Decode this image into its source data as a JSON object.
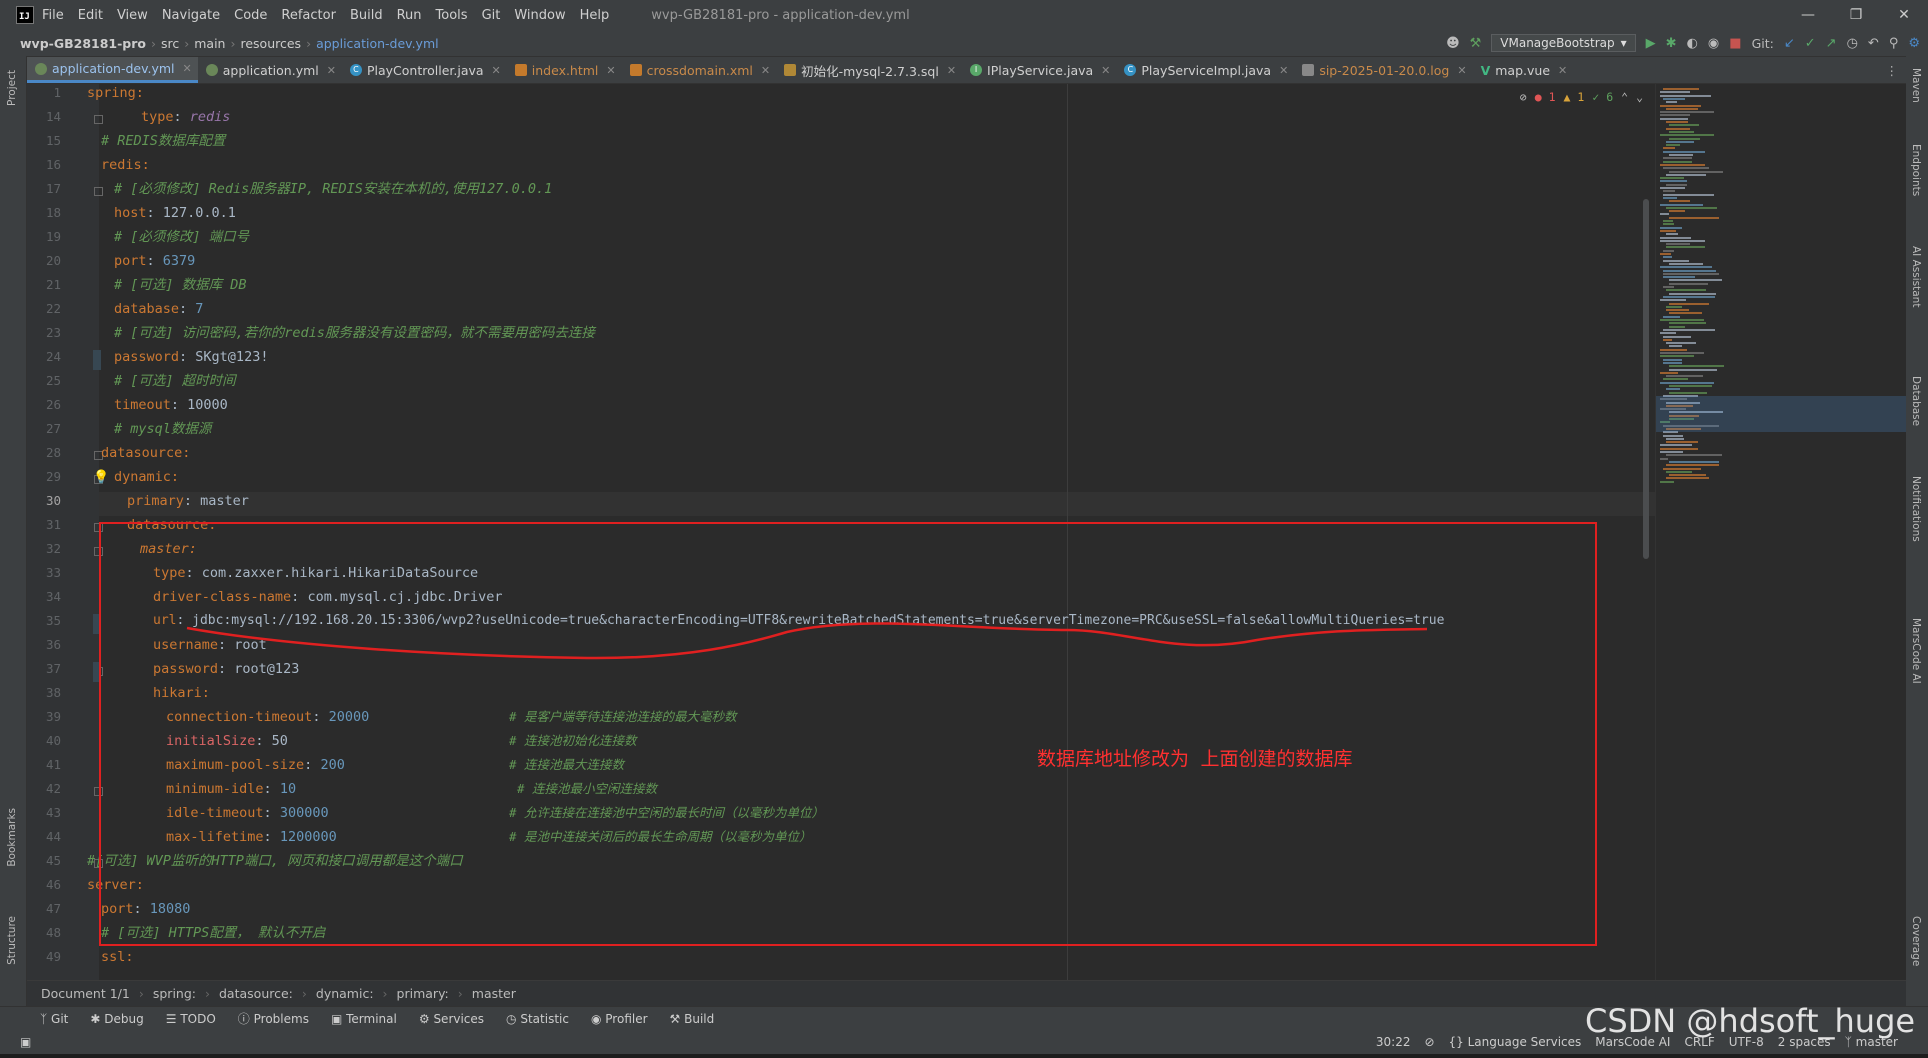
{
  "titlebar": {
    "menus": [
      "File",
      "Edit",
      "View",
      "Navigate",
      "Code",
      "Refactor",
      "Build",
      "Run",
      "Tools",
      "Git",
      "Window",
      "Help"
    ],
    "window_title": "wvp-GB28181-pro - application-dev.yml"
  },
  "navbar": {
    "crumbs": [
      "wvp-GB28181-pro",
      "src",
      "main",
      "resources",
      "application-dev.yml"
    ],
    "run_config": "VManageBootstrap",
    "git_label": "Git:"
  },
  "tabs": [
    {
      "label": "application-dev.yml",
      "active": true
    },
    {
      "label": "application.yml"
    },
    {
      "label": "PlayController.java"
    },
    {
      "label": "index.html"
    },
    {
      "label": "crossdomain.xml"
    },
    {
      "label": "初始化-mysql-2.7.3.sql"
    },
    {
      "label": "IPlayService.java"
    },
    {
      "label": "PlayServiceImpl.java"
    },
    {
      "label": "sip-2025-01-20.0.log"
    },
    {
      "label": "map.vue"
    }
  ],
  "inspections": {
    "errors": "1",
    "warnings": "1",
    "ok": "6"
  },
  "editor": {
    "line_numbers": [
      "1",
      "14",
      "15",
      "16",
      "17",
      "18",
      "19",
      "20",
      "21",
      "22",
      "23",
      "24",
      "25",
      "26",
      "27",
      "28",
      "29",
      "30",
      "31",
      "32",
      "33",
      "34",
      "35",
      "36",
      "37",
      "38",
      "39",
      "40",
      "41",
      "42",
      "43",
      "44",
      "45",
      "46",
      "47",
      "48",
      "49"
    ],
    "current_line": "30",
    "lines": {
      "l1": "spring:",
      "l14_key": "type",
      "l14_val": "redis",
      "l15": "# REDIS数据库配置",
      "l16": "redis:",
      "l17": "# [必须修改] Redis服务器IP, REDIS安装在本机的,使用127.0.0.1",
      "l18_key": "host",
      "l18_val": "127.0.0.1",
      "l19": "# [必须修改] 端口号",
      "l20_key": "port",
      "l20_val": "6379",
      "l21": "# [可选] 数据库 DB",
      "l22_key": "database",
      "l22_val": "7",
      "l23": "# [可选] 访问密码,若你的redis服务器没有设置密码，就不需要用密码去连接",
      "l24_key": "password",
      "l24_val": "SKgt@123!",
      "l25": "# [可选] 超时时间",
      "l26_key": "timeout",
      "l26_val": "10000",
      "l27": "# mysql数据源",
      "l28": "datasource:",
      "l29": "dynamic:",
      "l30_key": "primary",
      "l30_val": "master",
      "l31": "datasource:",
      "l32": "master:",
      "l33_key": "type",
      "l33_val": "com.zaxxer.hikari.HikariDataSource",
      "l34_key": "driver-class-name",
      "l34_val": "com.mysql.cj.jdbc.Driver",
      "l35_key": "url",
      "l35_val": "jdbc:mysql://192.168.20.15:3306/wvp2?useUnicode=true&characterEncoding=UTF8&rewriteBatchedStatements=true&serverTimezone=PRC&useSSL=false&allowMultiQueries=true",
      "l36_key": "username",
      "l36_val": "root",
      "l37_key": "password",
      "l37_val": "root@123",
      "l38": "hikari:",
      "l39_key": "connection-timeout",
      "l39_val": "20000",
      "l39_c": "# 是客户端等待连接池连接的最大毫秒数",
      "l40_key": "initialSize",
      "l40_val": "50",
      "l40_c": "# 连接池初始化连接数",
      "l41_key": "maximum-pool-size",
      "l41_val": "200",
      "l41_c": "# 连接池最大连接数",
      "l42_key": "minimum-idle",
      "l42_val": "10",
      "l42_c": "# 连接池最小空闲连接数",
      "l43_key": "idle-timeout",
      "l43_val": "300000",
      "l43_c": "# 允许连接在连接池中空闲的最长时间（以毫秒为单位）",
      "l44_key": "max-lifetime",
      "l44_val": "1200000",
      "l44_c": "# 是池中连接关闭后的最长生命周期（以毫秒为单位）",
      "l45": "#[可选] WVP监听的HTTP端口, 网页和接口调用都是这个端口",
      "l46": "server:",
      "l47_key": "port",
      "l47_val": "18080",
      "l48": "# [可选] HTTPS配置， 默认不开启",
      "l49": "ssl:"
    }
  },
  "annotation": {
    "note": "数据库地址修改为 上面创建的数据库",
    "color": "#e02020"
  },
  "breadcrumb_bar": [
    "Document 1/1",
    "spring:",
    "datasource:",
    "dynamic:",
    "primary:",
    "master"
  ],
  "tool_windows": [
    "Git",
    "Debug",
    "TODO",
    "Problems",
    "Terminal",
    "Services",
    "Statistic",
    "Profiler",
    "Build"
  ],
  "left_strip": [
    "Project",
    "Bookmarks",
    "Structure"
  ],
  "right_strip": [
    "Maven",
    "Endpoints",
    "AI Assistant",
    "Database",
    "Notifications",
    "MarsCode AI",
    "Coverage"
  ],
  "status": {
    "position": "30:22",
    "language_services": "Language Services",
    "marscode": "MarsCode AI",
    "line_sep": "CRLF",
    "encoding": "UTF-8",
    "indent": "2 spaces",
    "branch": "master"
  },
  "watermark": "CSDN @hdsoft_huge"
}
